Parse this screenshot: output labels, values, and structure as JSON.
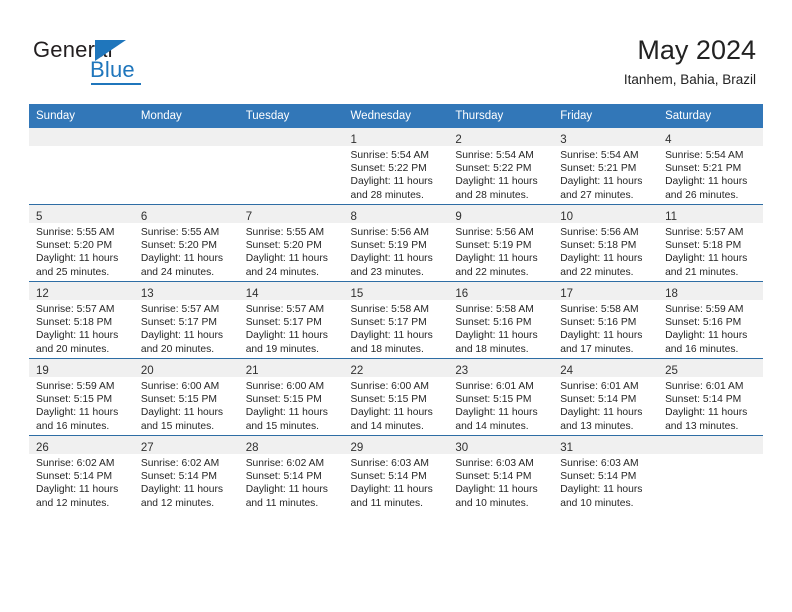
{
  "brand": {
    "name_top": "General",
    "name_bottom": "Blue",
    "accent_color": "#1f76bc"
  },
  "header": {
    "title": "May 2024",
    "subtitle": "Itanhem, Bahia, Brazil"
  },
  "theme": {
    "header_row_bg": "#3277b8",
    "row_separator": "#2e6da4",
    "daynum_band_bg": "#f0f0f0",
    "text_color": "#262626"
  },
  "weekday_headers": [
    "Sunday",
    "Monday",
    "Tuesday",
    "Wednesday",
    "Thursday",
    "Friday",
    "Saturday"
  ],
  "weeks": [
    [
      {
        "day": "",
        "type": "empty",
        "sunrise": "",
        "sunset": "",
        "daylight_a": "",
        "daylight_b": ""
      },
      {
        "day": "",
        "type": "empty",
        "sunrise": "",
        "sunset": "",
        "daylight_a": "",
        "daylight_b": ""
      },
      {
        "day": "",
        "type": "empty",
        "sunrise": "",
        "sunset": "",
        "daylight_a": "",
        "daylight_b": ""
      },
      {
        "day": "1",
        "type": "day",
        "sunrise": "Sunrise: 5:54 AM",
        "sunset": "Sunset: 5:22 PM",
        "daylight_a": "Daylight: 11 hours",
        "daylight_b": "and 28 minutes."
      },
      {
        "day": "2",
        "type": "day",
        "sunrise": "Sunrise: 5:54 AM",
        "sunset": "Sunset: 5:22 PM",
        "daylight_a": "Daylight: 11 hours",
        "daylight_b": "and 28 minutes."
      },
      {
        "day": "3",
        "type": "day",
        "sunrise": "Sunrise: 5:54 AM",
        "sunset": "Sunset: 5:21 PM",
        "daylight_a": "Daylight: 11 hours",
        "daylight_b": "and 27 minutes."
      },
      {
        "day": "4",
        "type": "day",
        "sunrise": "Sunrise: 5:54 AM",
        "sunset": "Sunset: 5:21 PM",
        "daylight_a": "Daylight: 11 hours",
        "daylight_b": "and 26 minutes."
      }
    ],
    [
      {
        "day": "5",
        "type": "day",
        "sunrise": "Sunrise: 5:55 AM",
        "sunset": "Sunset: 5:20 PM",
        "daylight_a": "Daylight: 11 hours",
        "daylight_b": "and 25 minutes."
      },
      {
        "day": "6",
        "type": "day",
        "sunrise": "Sunrise: 5:55 AM",
        "sunset": "Sunset: 5:20 PM",
        "daylight_a": "Daylight: 11 hours",
        "daylight_b": "and 24 minutes."
      },
      {
        "day": "7",
        "type": "day",
        "sunrise": "Sunrise: 5:55 AM",
        "sunset": "Sunset: 5:20 PM",
        "daylight_a": "Daylight: 11 hours",
        "daylight_b": "and 24 minutes."
      },
      {
        "day": "8",
        "type": "day",
        "sunrise": "Sunrise: 5:56 AM",
        "sunset": "Sunset: 5:19 PM",
        "daylight_a": "Daylight: 11 hours",
        "daylight_b": "and 23 minutes."
      },
      {
        "day": "9",
        "type": "day",
        "sunrise": "Sunrise: 5:56 AM",
        "sunset": "Sunset: 5:19 PM",
        "daylight_a": "Daylight: 11 hours",
        "daylight_b": "and 22 minutes."
      },
      {
        "day": "10",
        "type": "day",
        "sunrise": "Sunrise: 5:56 AM",
        "sunset": "Sunset: 5:18 PM",
        "daylight_a": "Daylight: 11 hours",
        "daylight_b": "and 22 minutes."
      },
      {
        "day": "11",
        "type": "day",
        "sunrise": "Sunrise: 5:57 AM",
        "sunset": "Sunset: 5:18 PM",
        "daylight_a": "Daylight: 11 hours",
        "daylight_b": "and 21 minutes."
      }
    ],
    [
      {
        "day": "12",
        "type": "day",
        "sunrise": "Sunrise: 5:57 AM",
        "sunset": "Sunset: 5:18 PM",
        "daylight_a": "Daylight: 11 hours",
        "daylight_b": "and 20 minutes."
      },
      {
        "day": "13",
        "type": "day",
        "sunrise": "Sunrise: 5:57 AM",
        "sunset": "Sunset: 5:17 PM",
        "daylight_a": "Daylight: 11 hours",
        "daylight_b": "and 20 minutes."
      },
      {
        "day": "14",
        "type": "day",
        "sunrise": "Sunrise: 5:57 AM",
        "sunset": "Sunset: 5:17 PM",
        "daylight_a": "Daylight: 11 hours",
        "daylight_b": "and 19 minutes."
      },
      {
        "day": "15",
        "type": "day",
        "sunrise": "Sunrise: 5:58 AM",
        "sunset": "Sunset: 5:17 PM",
        "daylight_a": "Daylight: 11 hours",
        "daylight_b": "and 18 minutes."
      },
      {
        "day": "16",
        "type": "day",
        "sunrise": "Sunrise: 5:58 AM",
        "sunset": "Sunset: 5:16 PM",
        "daylight_a": "Daylight: 11 hours",
        "daylight_b": "and 18 minutes."
      },
      {
        "day": "17",
        "type": "day",
        "sunrise": "Sunrise: 5:58 AM",
        "sunset": "Sunset: 5:16 PM",
        "daylight_a": "Daylight: 11 hours",
        "daylight_b": "and 17 minutes."
      },
      {
        "day": "18",
        "type": "day",
        "sunrise": "Sunrise: 5:59 AM",
        "sunset": "Sunset: 5:16 PM",
        "daylight_a": "Daylight: 11 hours",
        "daylight_b": "and 16 minutes."
      }
    ],
    [
      {
        "day": "19",
        "type": "day",
        "sunrise": "Sunrise: 5:59 AM",
        "sunset": "Sunset: 5:15 PM",
        "daylight_a": "Daylight: 11 hours",
        "daylight_b": "and 16 minutes."
      },
      {
        "day": "20",
        "type": "day",
        "sunrise": "Sunrise: 6:00 AM",
        "sunset": "Sunset: 5:15 PM",
        "daylight_a": "Daylight: 11 hours",
        "daylight_b": "and 15 minutes."
      },
      {
        "day": "21",
        "type": "day",
        "sunrise": "Sunrise: 6:00 AM",
        "sunset": "Sunset: 5:15 PM",
        "daylight_a": "Daylight: 11 hours",
        "daylight_b": "and 15 minutes."
      },
      {
        "day": "22",
        "type": "day",
        "sunrise": "Sunrise: 6:00 AM",
        "sunset": "Sunset: 5:15 PM",
        "daylight_a": "Daylight: 11 hours",
        "daylight_b": "and 14 minutes."
      },
      {
        "day": "23",
        "type": "day",
        "sunrise": "Sunrise: 6:01 AM",
        "sunset": "Sunset: 5:15 PM",
        "daylight_a": "Daylight: 11 hours",
        "daylight_b": "and 14 minutes."
      },
      {
        "day": "24",
        "type": "day",
        "sunrise": "Sunrise: 6:01 AM",
        "sunset": "Sunset: 5:14 PM",
        "daylight_a": "Daylight: 11 hours",
        "daylight_b": "and 13 minutes."
      },
      {
        "day": "25",
        "type": "day",
        "sunrise": "Sunrise: 6:01 AM",
        "sunset": "Sunset: 5:14 PM",
        "daylight_a": "Daylight: 11 hours",
        "daylight_b": "and 13 minutes."
      }
    ],
    [
      {
        "day": "26",
        "type": "day",
        "sunrise": "Sunrise: 6:02 AM",
        "sunset": "Sunset: 5:14 PM",
        "daylight_a": "Daylight: 11 hours",
        "daylight_b": "and 12 minutes."
      },
      {
        "day": "27",
        "type": "day",
        "sunrise": "Sunrise: 6:02 AM",
        "sunset": "Sunset: 5:14 PM",
        "daylight_a": "Daylight: 11 hours",
        "daylight_b": "and 12 minutes."
      },
      {
        "day": "28",
        "type": "day",
        "sunrise": "Sunrise: 6:02 AM",
        "sunset": "Sunset: 5:14 PM",
        "daylight_a": "Daylight: 11 hours",
        "daylight_b": "and 11 minutes."
      },
      {
        "day": "29",
        "type": "day",
        "sunrise": "Sunrise: 6:03 AM",
        "sunset": "Sunset: 5:14 PM",
        "daylight_a": "Daylight: 11 hours",
        "daylight_b": "and 11 minutes."
      },
      {
        "day": "30",
        "type": "day",
        "sunrise": "Sunrise: 6:03 AM",
        "sunset": "Sunset: 5:14 PM",
        "daylight_a": "Daylight: 11 hours",
        "daylight_b": "and 10 minutes."
      },
      {
        "day": "31",
        "type": "day",
        "sunrise": "Sunrise: 6:03 AM",
        "sunset": "Sunset: 5:14 PM",
        "daylight_a": "Daylight: 11 hours",
        "daylight_b": "and 10 minutes."
      },
      {
        "day": "",
        "type": "empty",
        "sunrise": "",
        "sunset": "",
        "daylight_a": "",
        "daylight_b": ""
      }
    ]
  ]
}
